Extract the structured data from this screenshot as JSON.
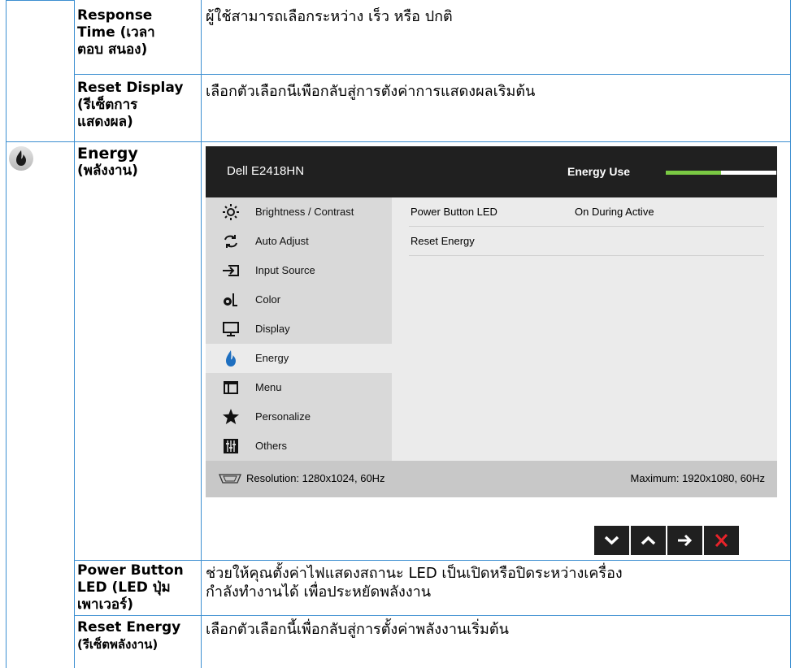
{
  "rows": [
    {
      "label": "Response Time (เวลาตอบ สนอง)",
      "label_lines": [
        "Response",
        "Time (เวลา",
        "ตอบ สนอง)"
      ],
      "text": "ผู้ใช้สามารถเลือกระหว่าง เร็ว หรือ ปกติ"
    },
    {
      "label_lines": [
        "Reset Display",
        "(รีเซ็ตการ",
        "แสดงผล)"
      ],
      "text": "เลือกตัวเลือกนีเพือกลับสู่การตังค่าการแสดงผลเริมต้น"
    },
    {
      "label_lines": [
        "Energy",
        "(พลังงาน)"
      ],
      "icon": "flame-icon"
    },
    {
      "label_lines": [
        "Power Button",
        "LED (LED ปุ่ม",
        "เพาเวอร์)"
      ],
      "text_lines": [
        "ช่วยให้คุณตั้งค่าไฟแสดงสถานะ LED เป็นเปิดหรือปิดระหว่างเครื่อง",
        "กำลังทำงานได้ เพื่อประหยัดพลังงาน"
      ]
    },
    {
      "label_lines": [
        "Reset Energy",
        "(รีเซ็ตพลังงาน)"
      ],
      "text": "เลือกตัวเลือกนี้เพื่อกลับสู่การตั้งค่าพลังงานเริ่มต้น"
    }
  ],
  "osd": {
    "model": "Dell E2418HN",
    "energy_use_label": "Energy Use",
    "energy_use_level": 0.5,
    "accent_color": "#7ac943",
    "menu": [
      {
        "label": "Brightness / Contrast",
        "icon": "sun-icon"
      },
      {
        "label": "Auto Adjust",
        "icon": "auto-adjust-icon"
      },
      {
        "label": "Input Source",
        "icon": "input-source-icon"
      },
      {
        "label": "Color",
        "icon": "color-icon"
      },
      {
        "label": "Display",
        "icon": "monitor-icon"
      },
      {
        "label": "Energy",
        "icon": "flame-icon",
        "active": true
      },
      {
        "label": "Menu",
        "icon": "menu-icon"
      },
      {
        "label": "Personalize",
        "icon": "star-icon"
      },
      {
        "label": "Others",
        "icon": "sliders-icon"
      }
    ],
    "settings": [
      {
        "name": "Power Button LED",
        "value": "On During Active"
      },
      {
        "name": "Reset Energy",
        "value": ""
      }
    ],
    "resolution": "Resolution: 1280x1024, 60Hz",
    "maximum": "Maximum: 1920x1080, 60Hz",
    "nav_buttons": [
      "down-icon",
      "up-icon",
      "right-arrow-icon",
      "close-icon"
    ]
  }
}
